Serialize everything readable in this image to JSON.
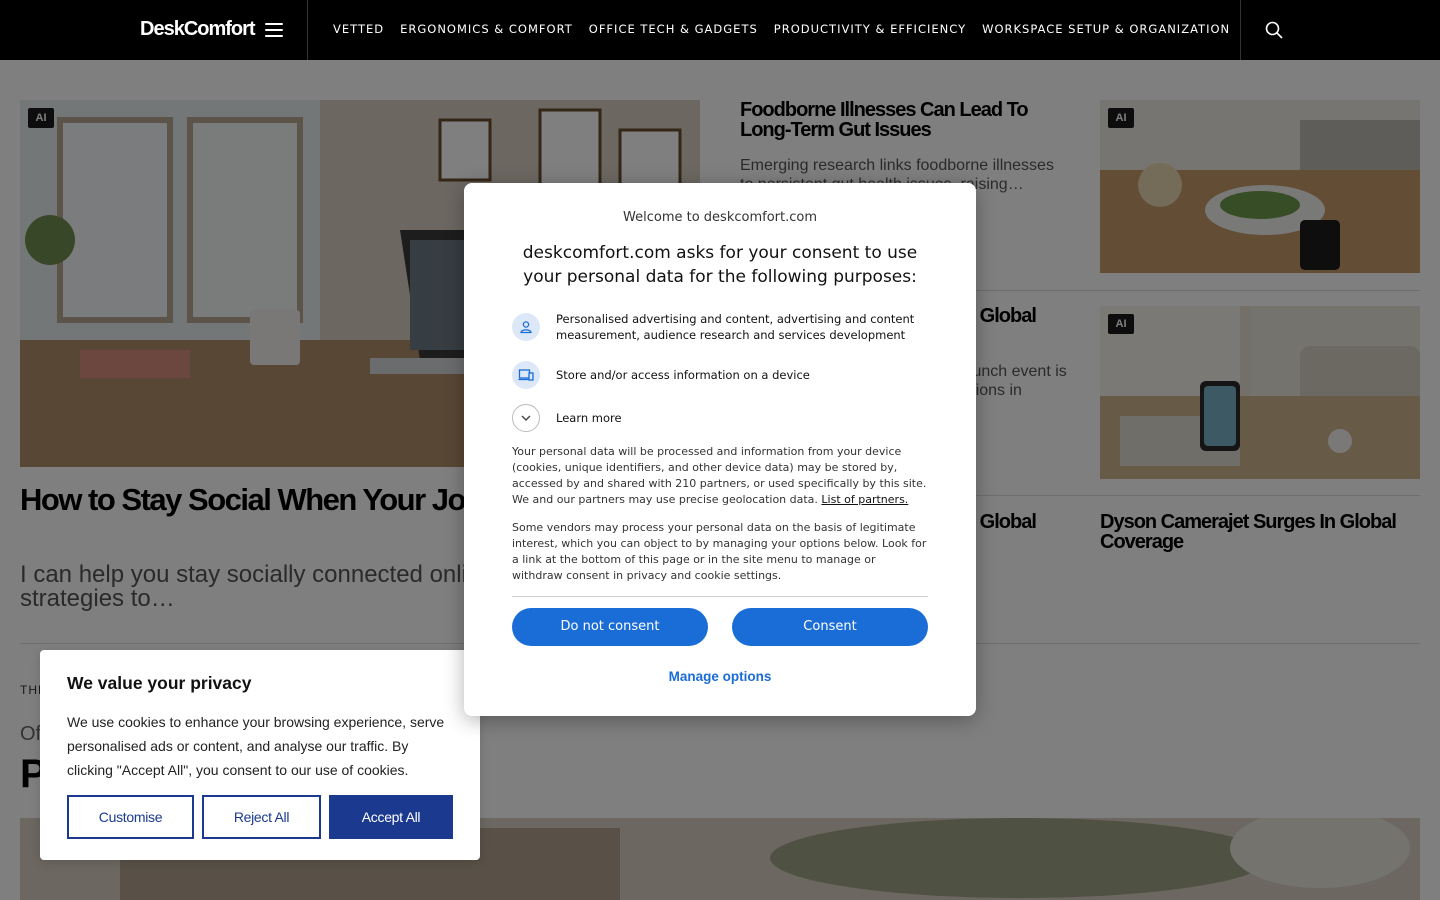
{
  "header": {
    "logo": "DeskComfort",
    "nav": [
      "VETTED",
      "ERGONOMICS & COMFORT",
      "OFFICE TECH & GADGETS",
      "PRODUCTIVITY & EFFICIENCY",
      "WORKSPACE SETUP & ORGANIZATION"
    ]
  },
  "hero": {
    "badge": "AI",
    "title": "How to Stay Social When Your Job Is Online",
    "desc": "I can help you stay socially connected online with the best strategies to…"
  },
  "articles": [
    {
      "title": "Foodborne Illnesses Can Lead To Long-Term Gut Issues",
      "desc": "Emerging research links foodborne illnesses to persistent gut health issues, raising…",
      "badge": "AI"
    },
    {
      "title": "Dyson Camerajet Surges In Global Coverage",
      "desc": "The Dyson Camerajet's recent launch event is making headlines across publications in",
      "badge": "AI"
    },
    {
      "title": "Dyson Camerajet Surges In Global Coverage",
      "desc": ""
    },
    {
      "title": "Dyson Camerajet Surges In Global Coverage",
      "desc": ""
    }
  ],
  "section": {
    "label": "THE",
    "sub": "Of",
    "big": "P"
  },
  "consent": {
    "welcome": "Welcome to deskcomfort.com",
    "headline": "deskcomfort.com asks for your consent to use your personal data for the following purposes:",
    "purposes": [
      "Personalised advertising and content, advertising and content measurement, audience research and services development",
      "Store and/or access information on a device"
    ],
    "learn_more": "Learn more",
    "para1": "Your personal data will be processed and information from your device (cookies, unique identifiers, and other device data) may be stored by, accessed by and shared with 210 partners, or used specifically by this site. We and our partners may use precise geolocation data.",
    "partners_link": "List of partners.",
    "para2": "Some vendors may process your personal data on the basis of legitimate interest, which you can object to by managing your options below. Look for a link at the bottom of this page or in the site menu to manage or withdraw consent in privacy and cookie settings.",
    "btn_decline": "Do not consent",
    "btn_accept": "Consent",
    "manage": "Manage options"
  },
  "cookie": {
    "title": "We value your privacy",
    "text": "We use cookies to enhance your browsing experience, serve personalised ads or content, and analyse our traffic. By clicking \"Accept All\", you consent to our use of cookies.",
    "customise": "Customise",
    "reject": "Reject All",
    "accept": "Accept All"
  },
  "colors": {
    "accent": "#1a6dd6",
    "cookie_accent": "#1b3a8f",
    "header_bg": "#000000"
  }
}
